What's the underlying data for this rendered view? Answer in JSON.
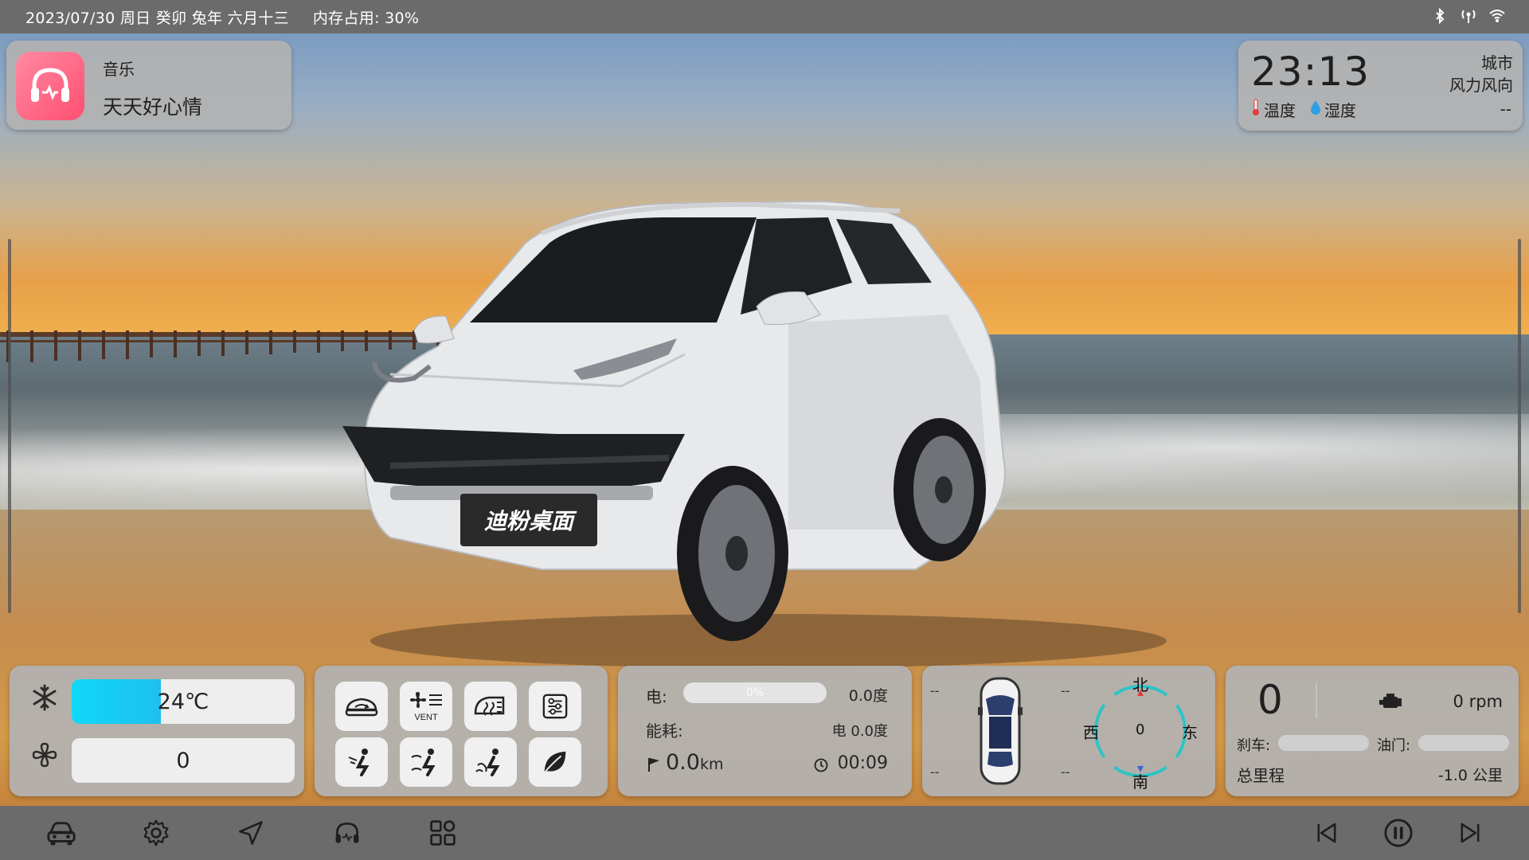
{
  "status_bar": {
    "datetime": "2023/07/30 周日 癸卯 兔年 六月十三",
    "memory": "内存占用: 30%",
    "icons": [
      "bluetooth-icon",
      "signal-icon",
      "wifi-icon"
    ]
  },
  "music": {
    "title": "音乐",
    "song": "天天好心情",
    "icon": "headphones-icon",
    "accent": "#ff5b7a"
  },
  "weather": {
    "time": "23:13",
    "city": "城市",
    "wind": "风力风向",
    "temp_label": "温度",
    "humidity_label": "湿度",
    "value": "--"
  },
  "car": {
    "badge": "迪粉桌面"
  },
  "climate": {
    "temperature": "24℃",
    "temperature_fill_percent": 40,
    "fan_speed": "0",
    "accent": "#18d2f5"
  },
  "controls": {
    "buttons": [
      {
        "name": "recirculation-button",
        "icon": "car-recirculation-icon"
      },
      {
        "name": "vent-button",
        "icon": "vent-icon",
        "label": "VENT"
      },
      {
        "name": "defrost-button",
        "icon": "defrost-icon"
      },
      {
        "name": "settings-sliders-button",
        "icon": "sliders-icon"
      },
      {
        "name": "seat-face-button",
        "icon": "seat-face-icon"
      },
      {
        "name": "seat-face-feet-button",
        "icon": "seat-face-feet-icon"
      },
      {
        "name": "seat-feet-button",
        "icon": "seat-feet-icon"
      },
      {
        "name": "eco-button",
        "icon": "leaf-icon"
      }
    ]
  },
  "energy": {
    "electric_label": "电:",
    "battery_percent_text": "0%",
    "battery_percent": 0,
    "electric_value": "0.0度",
    "consumption_label": "能耗:",
    "consumption_value": "电 0.0度",
    "distance": "0.0",
    "distance_unit": "km",
    "trip_time": "00:09"
  },
  "compass": {
    "tire_fl": "--",
    "tire_fr": "--",
    "tire_rl": "--",
    "tire_rr": "--",
    "north": "北",
    "south": "南",
    "east": "东",
    "west": "西",
    "heading": "0"
  },
  "engine": {
    "speed": "0",
    "rpm": "0 rpm",
    "brake_label": "刹车:",
    "throttle_label": "油门:",
    "odometer_label": "总里程",
    "odometer_value": "-1.0 公里",
    "brake_level": 0,
    "throttle_level": 0
  },
  "navbar": {
    "left_buttons": [
      "car-icon",
      "settings-icon",
      "navigation-icon",
      "headphones-icon",
      "apps-icon"
    ],
    "right_buttons": [
      "previous-icon",
      "pause-icon",
      "next-icon"
    ]
  }
}
